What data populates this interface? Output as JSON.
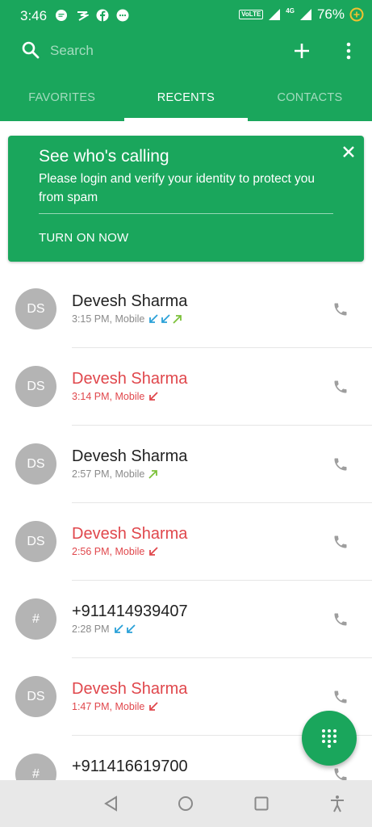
{
  "status": {
    "time": "3:46",
    "volte": "VoLTE",
    "network": "4G",
    "battery": "76%"
  },
  "search": {
    "placeholder": "Search"
  },
  "tabs": [
    {
      "label": "FAVORITES"
    },
    {
      "label": "RECENTS"
    },
    {
      "label": "CONTACTS"
    }
  ],
  "banner": {
    "title": "See who's calling",
    "text": "Please login and verify your identity to protect you from spam",
    "action": "TURN ON NOW"
  },
  "calls": [
    {
      "initials": "DS",
      "name": "Devesh Sharma",
      "detail": "3:15 PM, Mobile",
      "missed": false
    },
    {
      "initials": "DS",
      "name": "Devesh Sharma",
      "detail": "3:14 PM, Mobile",
      "missed": true
    },
    {
      "initials": "DS",
      "name": "Devesh Sharma",
      "detail": "2:57 PM, Mobile",
      "missed": false
    },
    {
      "initials": "DS",
      "name": "Devesh Sharma",
      "detail": "2:56 PM, Mobile",
      "missed": true
    },
    {
      "initials": "#",
      "name": "+911414939407",
      "detail": "2:28 PM",
      "missed": false
    },
    {
      "initials": "DS",
      "name": "Devesh Sharma",
      "detail": "1:47 PM, Mobile",
      "missed": true
    },
    {
      "initials": "#",
      "name": "+911416619700",
      "detail": "",
      "missed": false
    }
  ],
  "colors": {
    "brand": "#1aa65c",
    "missed": "#e0474c",
    "incoming": "#2aa1d8",
    "outgoing": "#7cc13a"
  },
  "icons": [
    "search-icon",
    "plus-icon",
    "more-vert-icon",
    "close-icon",
    "phone-icon",
    "dialpad-icon",
    "back-icon",
    "home-icon",
    "recents-icon",
    "accessibility-icon"
  ]
}
